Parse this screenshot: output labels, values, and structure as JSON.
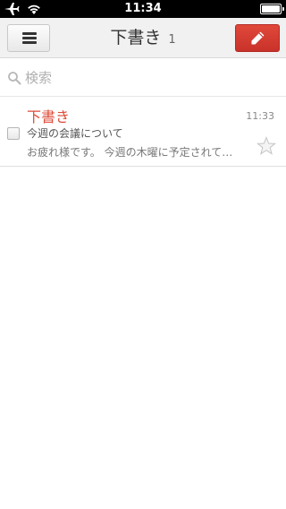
{
  "status_bar": {
    "time": "11:34",
    "battery_level": 1.0
  },
  "header": {
    "title": "下書き",
    "count": "1",
    "menu_icon": "hamburger-menu-icon",
    "compose_icon": "pencil-icon"
  },
  "search": {
    "placeholder": "検索",
    "value": ""
  },
  "mail_list": [
    {
      "sender": "下書き",
      "time": "11:33",
      "subject": "今週の会議について",
      "snippet": "お疲れ様です。 今週の木曜に予定されて…",
      "starred": false
    }
  ],
  "colors": {
    "accent_red": "#dd4b39",
    "header_bg": "#f1f1f1"
  }
}
